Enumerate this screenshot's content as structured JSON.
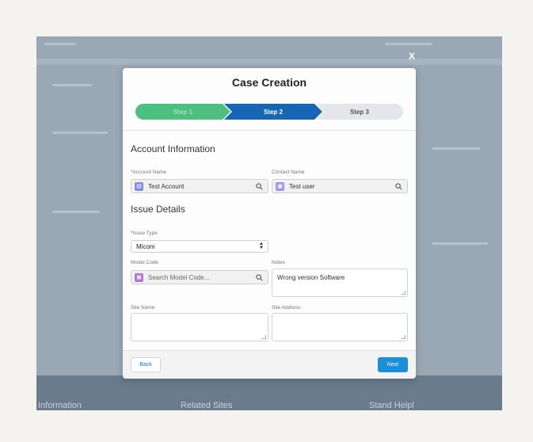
{
  "modal": {
    "title": "Case Creation",
    "close_label": "X"
  },
  "stepper": {
    "steps": [
      {
        "label": "Step 1",
        "state": "complete"
      },
      {
        "label": "Step 2",
        "state": "current"
      },
      {
        "label": "Step 3",
        "state": "upcoming"
      }
    ]
  },
  "account_section": {
    "title": "Account Information",
    "account_name": {
      "label": "Account Name",
      "required_mark": "*",
      "value": "Test Account"
    },
    "contact_name": {
      "label": "Contact Name",
      "value": "Test user"
    }
  },
  "issue_section": {
    "title": "Issue Details",
    "issue_type": {
      "label": "Issue Type",
      "required_mark": "*",
      "value": "Micom"
    },
    "model_code": {
      "label": "Model Code",
      "placeholder": "Search Model Code..."
    },
    "notes": {
      "label": "Notes",
      "value": "Wrong version Software"
    },
    "site_name": {
      "label": "Site Name",
      "value": ""
    },
    "site_address": {
      "label": "Site Address",
      "value": ""
    }
  },
  "footer": {
    "back_label": "Back",
    "next_label": "Next"
  },
  "background": {
    "bottom_tabs": [
      "Information",
      "Related Sites",
      "Stand Helpl"
    ]
  },
  "colors": {
    "step_complete": "#4cc17f",
    "step_current": "#1766b5",
    "step_upcoming": "#e4e6e9",
    "account_icon": "#7f8de1",
    "contact_icon": "#a094ed",
    "model_icon": "#b472d6",
    "primary_button": "#1a8ddb",
    "required": "#c23934"
  },
  "icons": {
    "account": "account-icon",
    "contact": "contact-icon",
    "model": "product-icon",
    "search": "search-icon",
    "select_arrows": "chevron-updown-icon"
  }
}
